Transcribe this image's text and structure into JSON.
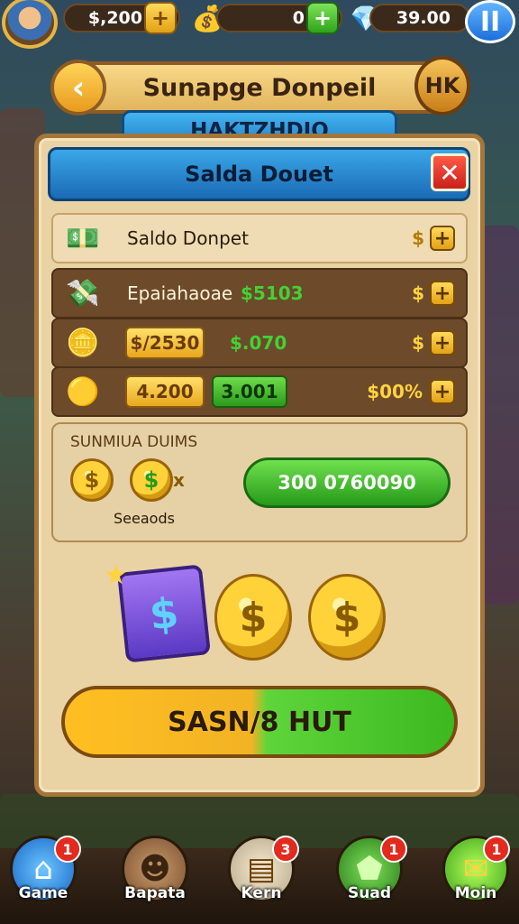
{
  "top_bar": {
    "gold": "$,200",
    "gems": "0",
    "cash": "39.00",
    "plus": "+",
    "pause": "II"
  },
  "title": "Sunapge Donpeil",
  "corner_label": "HK",
  "subtab": "HAKTZHDIO",
  "panel_header": "Salda Douet",
  "close": "✕",
  "rows": [
    {
      "label": "Saldo Donpet",
      "dollar": "$",
      "plus": "+"
    },
    {
      "label": "Epaiahaoae",
      "value": "$5103",
      "dollar": "$",
      "plus": "+"
    },
    {
      "pill_yellow": "$/2530",
      "value": "$.070",
      "dollar": "$",
      "plus": "+"
    },
    {
      "pill_yellow": "4.200",
      "pill_green": "3.001",
      "value": "$00%",
      "plus": "+"
    }
  ],
  "bonus": {
    "title": "SUNMIUA DUIMS",
    "subtitle": "Seeaods",
    "coin_x": "x",
    "claim": "300 0760090"
  },
  "big_button": "SASN/8 HUT",
  "nav": [
    {
      "label": "Game",
      "badge": "1",
      "icon": "home-icon"
    },
    {
      "label": "Bapata",
      "badge": "",
      "icon": "character-icon"
    },
    {
      "label": "Kern",
      "badge": "3",
      "icon": "scroll-icon"
    },
    {
      "label": "Suad",
      "badge": "1",
      "icon": "shield-icon"
    },
    {
      "label": "Moin",
      "badge": "1",
      "icon": "ticket-icon"
    }
  ]
}
